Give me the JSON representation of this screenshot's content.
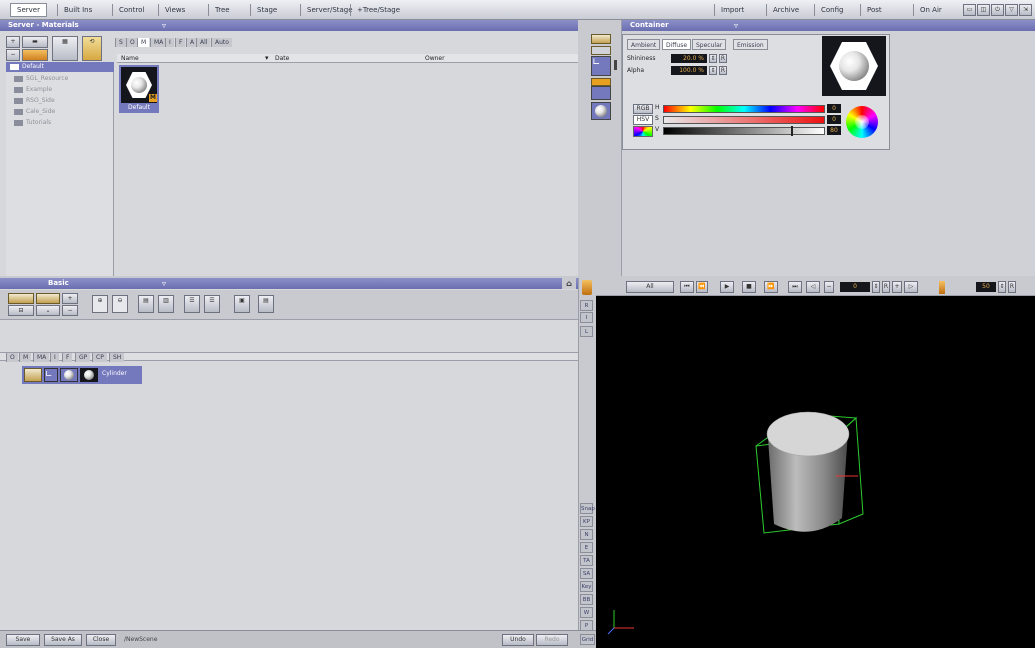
{
  "menubar": {
    "tabs": [
      "Server",
      "Built Ins",
      "Control",
      "Views",
      "Tree",
      "Stage",
      "Server/Stage",
      "+Tree/Stage"
    ],
    "right_tabs": [
      "Import",
      "Archive",
      "Config",
      "Post",
      "On Air"
    ]
  },
  "server_panel": {
    "title": "Server - Materials",
    "filters": [
      "S",
      "O",
      "M",
      "MA",
      "I",
      "F",
      "A",
      "All",
      "Auto"
    ],
    "columns": [
      "Name",
      "Date",
      "Owner"
    ],
    "tree": [
      {
        "label": "Default",
        "selected": true
      },
      {
        "label": "SGL_Resource"
      },
      {
        "label": "Example"
      },
      {
        "label": "RSO_Side"
      },
      {
        "label": "Cale_Side"
      },
      {
        "label": "Tutorials"
      }
    ],
    "material": {
      "label": "Default"
    }
  },
  "container_panel": {
    "title": "Container",
    "tabs": [
      "Ambient",
      "Diffuse",
      "Specular",
      "Emission"
    ],
    "active_tab": "Diffuse",
    "shininess_label": "Shininess",
    "shininess_value": "20.0 %",
    "alpha_label": "Alpha",
    "alpha_value": "100.0 %",
    "color_modes": [
      "RGB",
      "HSV"
    ],
    "channels": [
      {
        "name": "H",
        "value": "0"
      },
      {
        "name": "S",
        "value": "0"
      },
      {
        "name": "V",
        "value": "80"
      }
    ]
  },
  "basic_panel": {
    "title": "Basic",
    "filters": [
      "O",
      "M",
      "MA",
      "I",
      "F",
      "GP",
      "CP",
      "SH"
    ],
    "node": {
      "label": "Cylinder"
    },
    "side_letters": [
      "I",
      "L"
    ]
  },
  "viewport": {
    "all_label": "All",
    "frame_value": "0",
    "speed_value": "50",
    "side_buttons": [
      "Snap",
      "KP",
      "N",
      "E",
      "TA",
      "SA",
      "Key",
      "BB",
      "W",
      "P",
      "Grid"
    ]
  },
  "statusbar": {
    "save": "Save",
    "save_as": "Save As",
    "close": "Close",
    "scene": "/NewScene",
    "undo": "Undo",
    "redo": "Redo"
  },
  "colors": {
    "accent": "#7478bc",
    "panel": "#d6d8dc",
    "viewport_bg": "#000000",
    "bbox": "#2ecc2e"
  }
}
